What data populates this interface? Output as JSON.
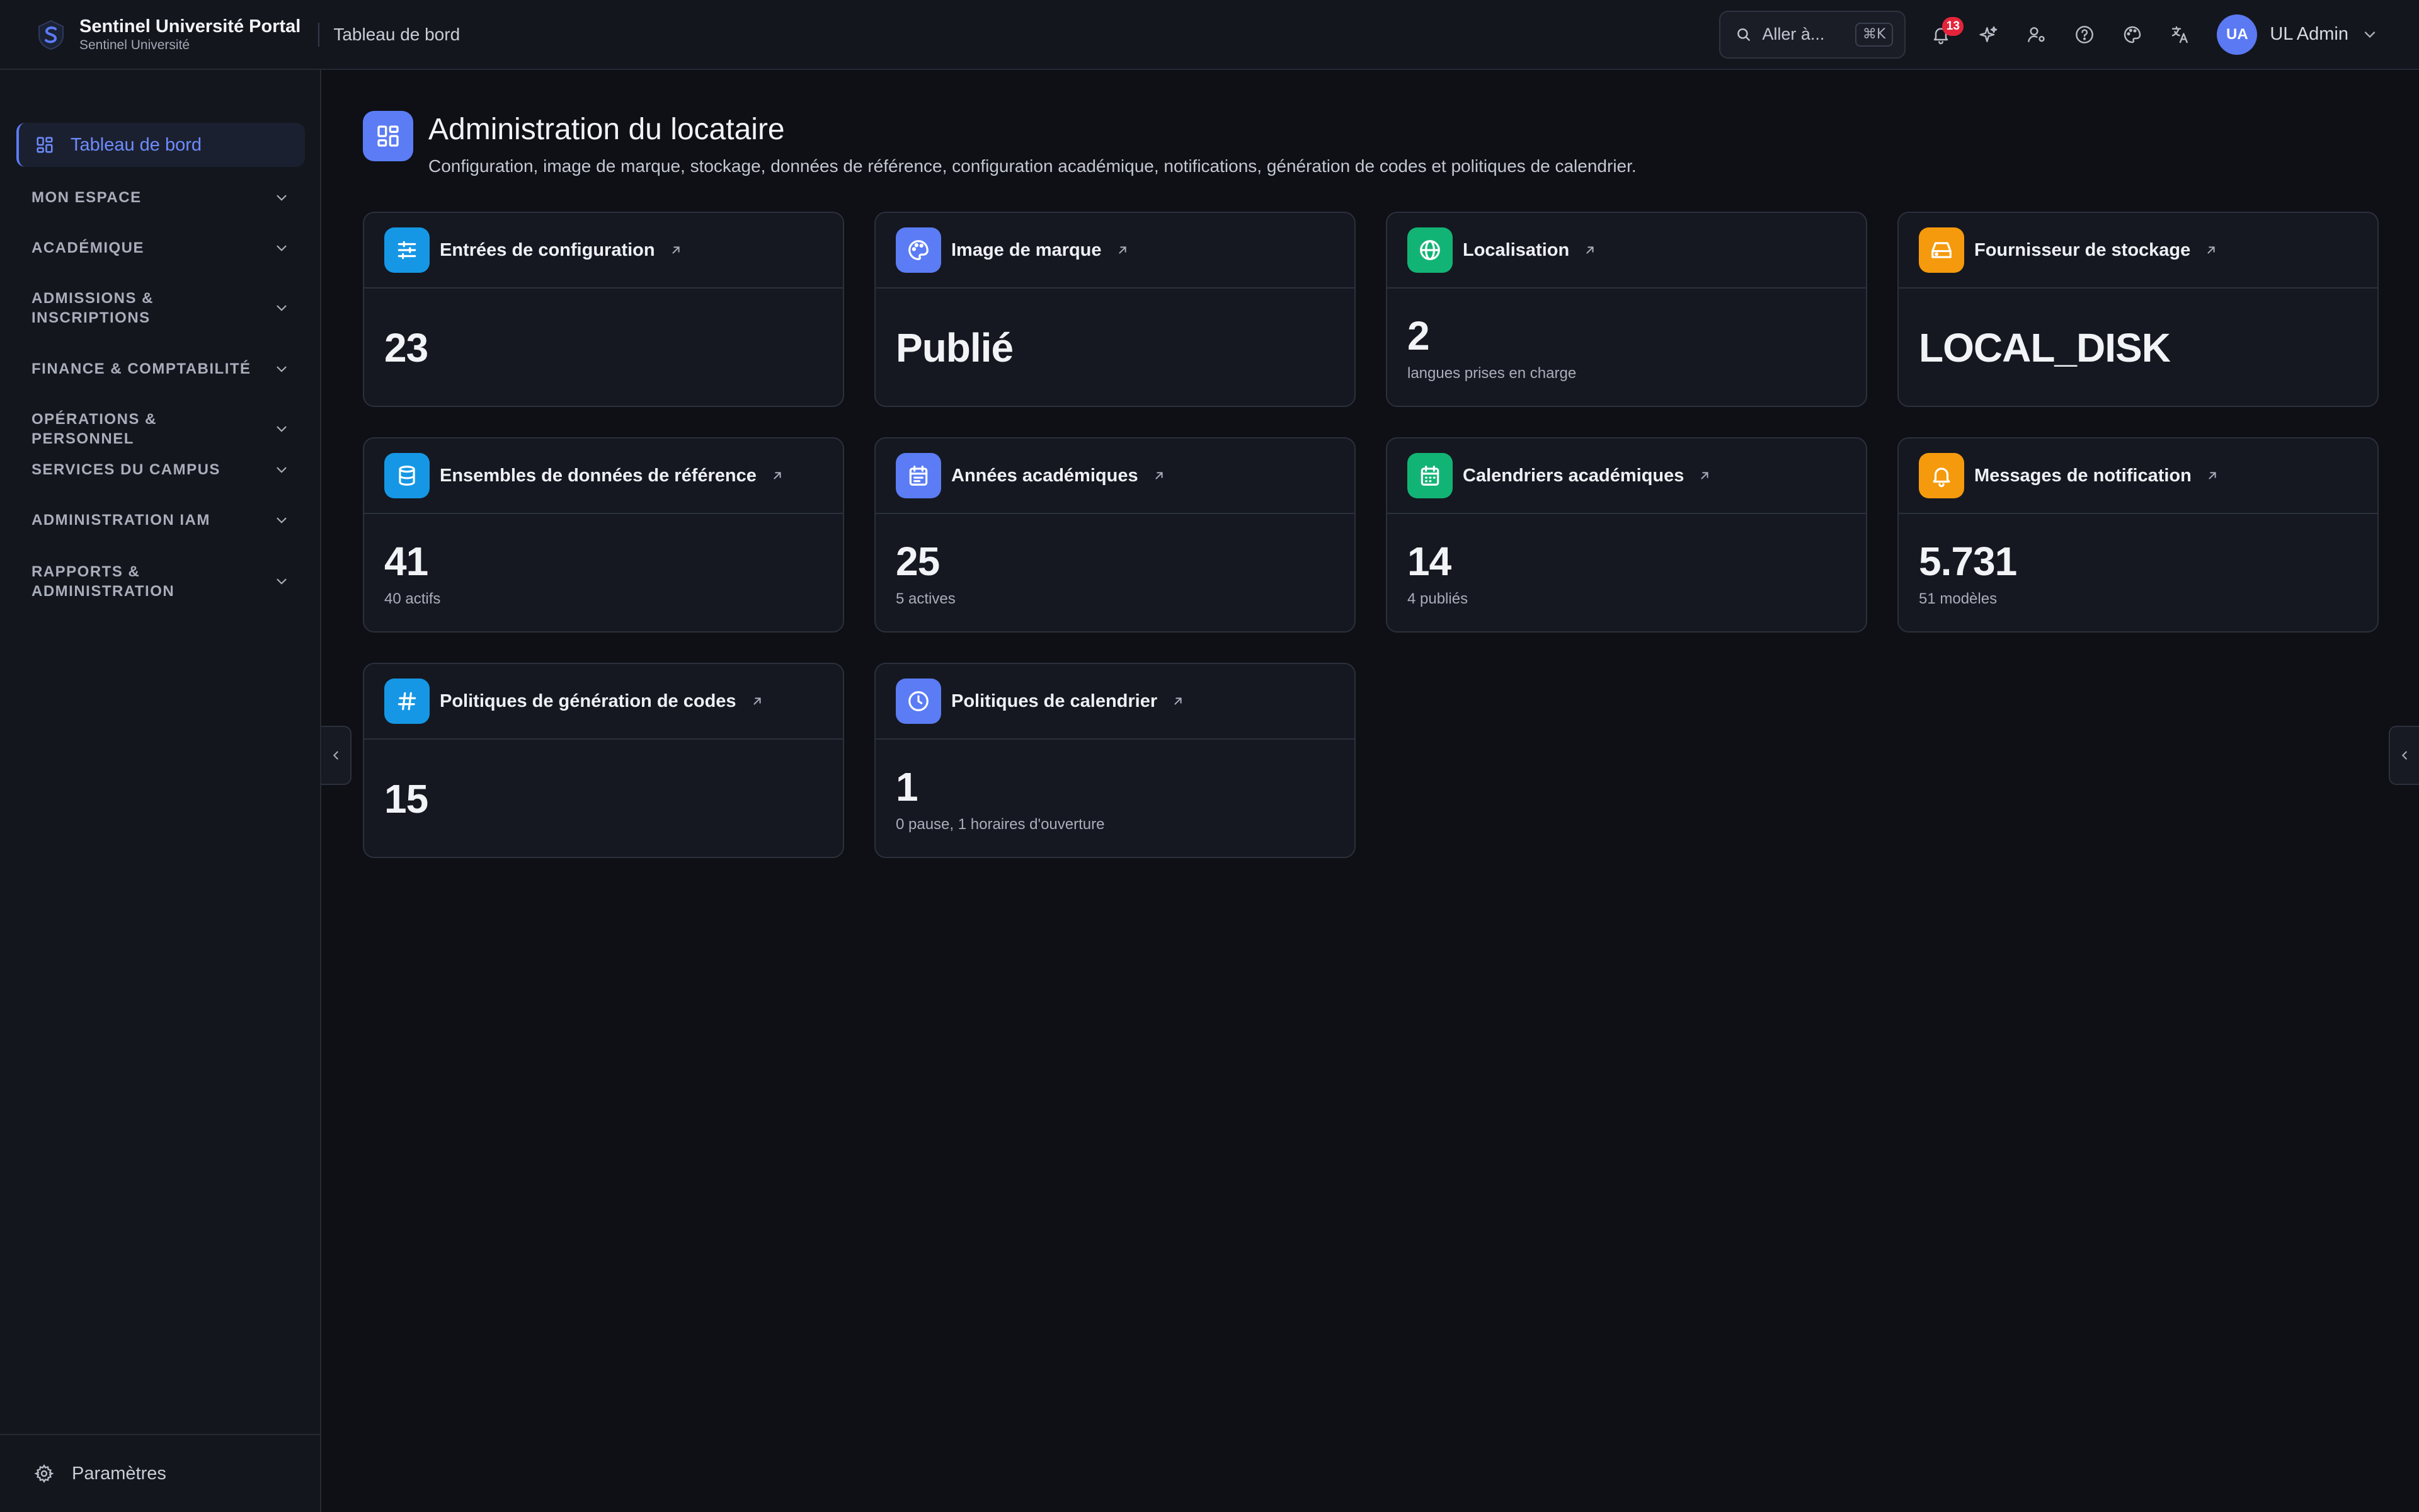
{
  "header": {
    "app_title": "Sentinel Université Portal",
    "app_subtitle": "Sentinel Université",
    "breadcrumb": "Tableau de bord",
    "search": {
      "label": "Aller à...",
      "shortcut": "⌘K"
    },
    "notifications_count": "13",
    "user": {
      "initials": "UA",
      "name": "UL Admin"
    },
    "icons": [
      "bell-icon",
      "sparkles-icon",
      "user-settings-icon",
      "help-icon",
      "palette-icon",
      "translate-icon"
    ]
  },
  "sidebar": {
    "active_item": "Tableau de bord",
    "groups": [
      "MON ESPACE",
      "ACADÉMIQUE",
      "ADMISSIONS & INSCRIPTIONS",
      "FINANCE & COMPTABILITÉ",
      "OPÉRATIONS & PERSONNEL",
      "SERVICES DU CAMPUS",
      "ADMINISTRATION IAM",
      "RAPPORTS & ADMINISTRATION"
    ],
    "settings_label": "Paramètres"
  },
  "main": {
    "title": "Administration du locataire",
    "subtitle": "Configuration, image de marque, stockage, données de référence, configuration académique, notifications, génération de codes et politiques de calendrier.",
    "cards": [
      {
        "title": "Entrées de configuration",
        "value": "23",
        "note": "",
        "icon": "sliders-icon",
        "color": "#1597e5"
      },
      {
        "title": "Image de marque",
        "value": "Publié",
        "note": "",
        "icon": "palette-icon",
        "color": "#5b7cf5"
      },
      {
        "title": "Localisation",
        "value": "2",
        "note": "langues prises en charge",
        "icon": "globe-icon",
        "color": "#12b475"
      },
      {
        "title": "Fournisseur de stockage",
        "value": "LOCAL_DISK",
        "note": "",
        "icon": "hard-drive-icon",
        "color": "#f59a0d"
      },
      {
        "title": "Ensembles de données de référence",
        "value": "41",
        "note": "40 actifs",
        "icon": "database-icon",
        "color": "#1597e5"
      },
      {
        "title": "Années académiques",
        "value": "25",
        "note": "5 actives",
        "icon": "calendar-list-icon",
        "color": "#5b7cf5"
      },
      {
        "title": "Calendriers académiques",
        "value": "14",
        "note": "4 publiés",
        "icon": "calendar-icon",
        "color": "#12b475"
      },
      {
        "title": "Messages de notification",
        "value": "5.731",
        "note": "51 modèles",
        "icon": "bell-icon",
        "color": "#f59a0d"
      },
      {
        "title": "Politiques de génération de codes",
        "value": "15",
        "note": "",
        "icon": "hash-icon",
        "color": "#1597e5"
      },
      {
        "title": "Politiques de calendrier",
        "value": "1",
        "note": "0 pause, 1 horaires d'ouverture",
        "icon": "clock-icon",
        "color": "#5b7cf5"
      }
    ]
  }
}
